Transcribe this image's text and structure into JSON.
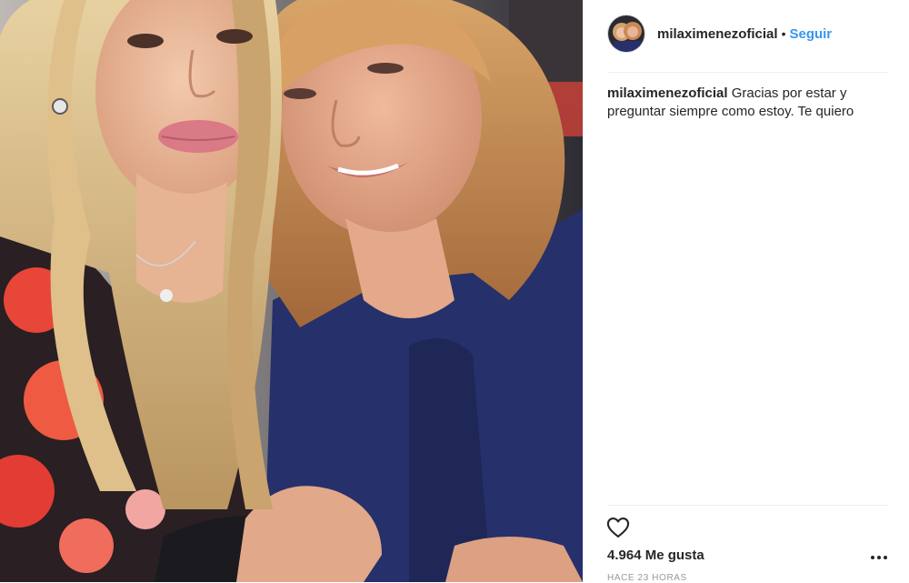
{
  "post": {
    "username": "milaximenezoficial",
    "separator": "•",
    "follow_label": "Seguir",
    "caption_user": "milaximenezoficial",
    "caption_text": "Gracias por estar y preguntar siempre como estoy. Te quiero",
    "likes": "4.964 Me gusta",
    "timestamp": "HACE 23 HORAS"
  },
  "icons": {
    "like": "heart-outline-icon",
    "more": "more-options-icon"
  },
  "colors": {
    "link_blue": "#3897f0",
    "text_dark": "#262626",
    "text_muted": "#999999"
  }
}
